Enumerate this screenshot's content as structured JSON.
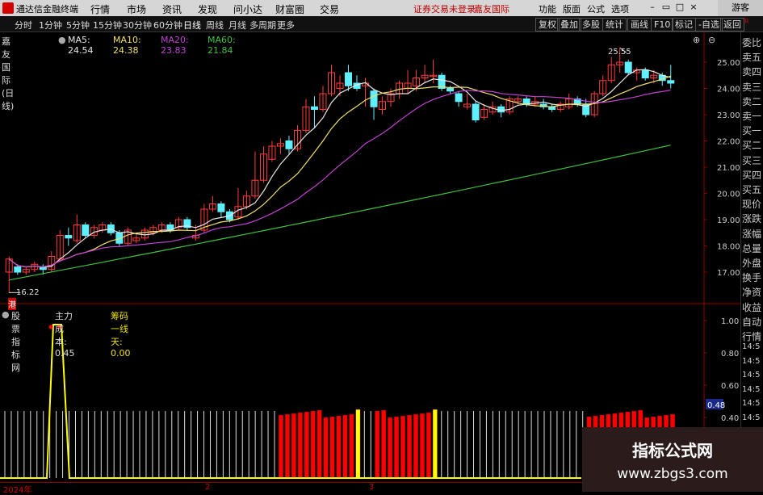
{
  "app": {
    "title": "通达信金融终端",
    "menus": [
      "行情",
      "市场",
      "资讯",
      "发现",
      "问小达",
      "财富圈",
      "交易"
    ],
    "notice": "证券交易未登录",
    "stock_name_top": "嘉友国际",
    "top_right": [
      "功能",
      "版面",
      "公式",
      "选项"
    ],
    "guest": "游客"
  },
  "toolbar": {
    "periods": [
      "分时",
      "1分钟",
      "5分钟",
      "15分钟",
      "30分钟",
      "60分钟",
      "日线",
      "周线",
      "月线",
      "多周期",
      "更多"
    ],
    "active_period": "日线",
    "right_buttons": [
      "复权",
      "叠加",
      "多股",
      "统计",
      "画线",
      "F10",
      "标记",
      "-自选",
      "返回"
    ]
  },
  "main_chart": {
    "stock_label": "嘉友国际(日线)",
    "ma5": "MA5: 24.54",
    "ma10": "MA10: 24.38",
    "ma20": "MA20: 23.83",
    "ma60": "MA60: 21.84",
    "high_label": "25.55",
    "low_label": "16.22",
    "low_marker": "港",
    "y_ticks": [
      "25.00",
      "24.00",
      "23.00",
      "22.00",
      "21.00",
      "20.00",
      "19.00",
      "18.00",
      "17.00"
    ],
    "colors": {
      "up": "#ff3b3b",
      "down": "#5ff0ff",
      "ma5": "#e8e8e8",
      "ma10": "#f0e068",
      "ma20": "#c040d0",
      "ma60": "#40c040",
      "grid": "#8b0000"
    }
  },
  "sub_chart": {
    "indicator": "股票指标网",
    "main_cost": "主力成本: 0.45",
    "chip_line": "筹码一线天: 0.00",
    "y_ticks": [
      "1.00",
      "0.80",
      "0.60",
      "0.40"
    ],
    "current_value": "0.48"
  },
  "right_panel": {
    "labels": [
      "委比",
      "卖五",
      "卖四",
      "卖三",
      "卖二",
      "卖一",
      "买一",
      "买二",
      "买三",
      "买四",
      "买五",
      "现价",
      "涨跌",
      "涨幅",
      "总量",
      "外盘",
      "换手",
      "净资",
      "收益",
      "自动",
      "行情"
    ],
    "times": [
      "14:5",
      "14:5",
      "14:5",
      "14:5",
      "14:5",
      "14:5"
    ]
  },
  "bottom_axis": {
    "labels": [
      "2024年",
      "2",
      "3"
    ]
  },
  "watermark": {
    "line1": "指标公式网",
    "line2": "www.zbgs3.com"
  }
}
